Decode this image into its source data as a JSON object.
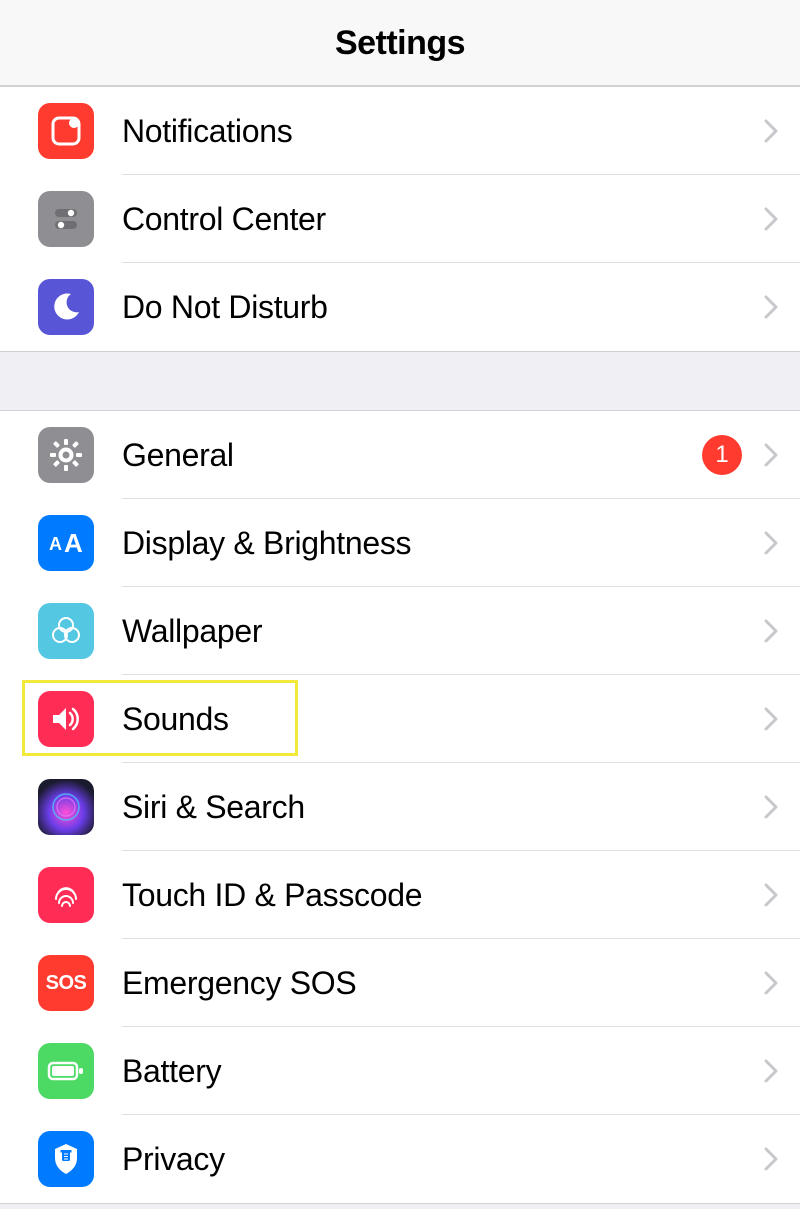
{
  "header": {
    "title": "Settings"
  },
  "groups": [
    {
      "rows": [
        {
          "label": "Notifications",
          "icon": "notifications-icon",
          "bg": "#ff3b30",
          "badge": null
        },
        {
          "label": "Control Center",
          "icon": "control-center-icon",
          "bg": "#8e8e93",
          "badge": null
        },
        {
          "label": "Do Not Disturb",
          "icon": "do-not-disturb-icon",
          "bg": "#5856d6",
          "badge": null
        }
      ]
    },
    {
      "rows": [
        {
          "label": "General",
          "icon": "general-icon",
          "bg": "#8e8e93",
          "badge": "1"
        },
        {
          "label": "Display & Brightness",
          "icon": "display-brightness-icon",
          "bg": "#007aff",
          "badge": null
        },
        {
          "label": "Wallpaper",
          "icon": "wallpaper-icon",
          "bg": "#54c7e3",
          "badge": null
        },
        {
          "label": "Sounds",
          "icon": "sounds-icon",
          "bg": "#ff2d55",
          "badge": null,
          "highlighted": true
        },
        {
          "label": "Siri & Search",
          "icon": "siri-icon",
          "bg": "siri-gradient",
          "badge": null
        },
        {
          "label": "Touch ID & Passcode",
          "icon": "touch-id-icon",
          "bg": "#ff2d55",
          "badge": null
        },
        {
          "label": "Emergency SOS",
          "icon": "emergency-sos-icon",
          "bg": "#ff3b30",
          "badge": null,
          "text": "SOS"
        },
        {
          "label": "Battery",
          "icon": "battery-icon",
          "bg": "#4cd964",
          "badge": null
        },
        {
          "label": "Privacy",
          "icon": "privacy-icon",
          "bg": "#007aff",
          "badge": null
        }
      ]
    }
  ]
}
